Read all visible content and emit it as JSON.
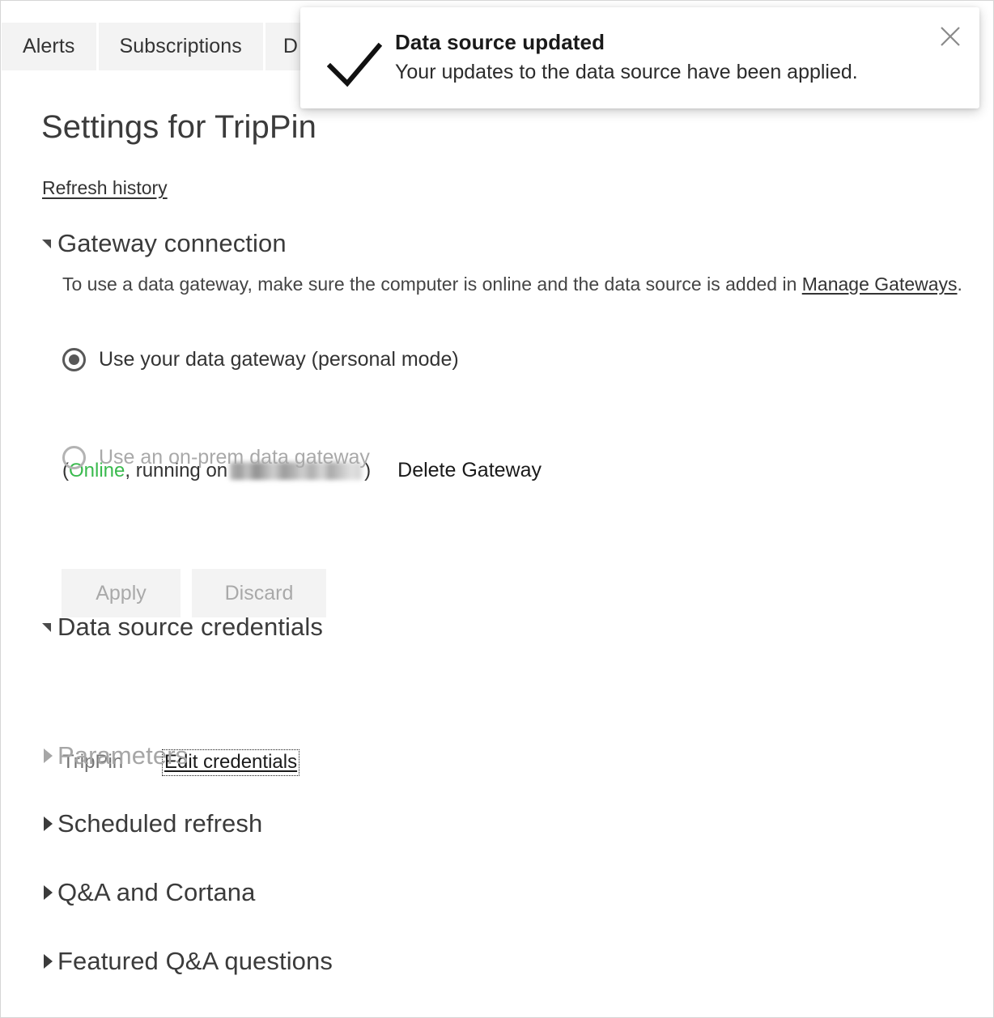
{
  "tabs": [
    {
      "label": "Alerts"
    },
    {
      "label": "Subscriptions"
    },
    {
      "label": "D"
    }
  ],
  "page": {
    "title": "Settings for TripPin",
    "refresh_history_label": "Refresh history"
  },
  "toast": {
    "icon": "checkmark-icon",
    "title": "Data source updated",
    "message": "Your updates to the data source have been applied.",
    "close_icon": "close-icon"
  },
  "gateway_section": {
    "title": "Gateway connection",
    "expanded": true,
    "description_prefix": "To use a data gateway, make sure the computer is online and the data source is added in ",
    "description_link": "Manage Gateways",
    "description_suffix": ".",
    "options": [
      {
        "label": "Use your data gateway (personal mode)",
        "selected": true,
        "disabled": false
      },
      {
        "label": "Use an on-prem data gateway",
        "selected": false,
        "disabled": true
      }
    ],
    "status": {
      "open_paren": "(",
      "state": "Online",
      "state_color": "#3aba4e",
      "running_on": ", running on ",
      "machine_name": "",
      "close_paren": ")"
    },
    "delete_gateway_label": "Delete Gateway",
    "buttons": {
      "apply_label": "Apply",
      "discard_label": "Discard"
    }
  },
  "credentials_section": {
    "title": "Data source credentials",
    "expanded": true,
    "rows": [
      {
        "name": "TripPin",
        "action_label": "Edit credentials"
      }
    ]
  },
  "collapsed_sections": [
    {
      "title": "Parameters",
      "disabled": true
    },
    {
      "title": "Scheduled refresh",
      "disabled": false
    },
    {
      "title": "Q&A and Cortana",
      "disabled": false
    },
    {
      "title": "Featured Q&A questions",
      "disabled": false
    }
  ]
}
